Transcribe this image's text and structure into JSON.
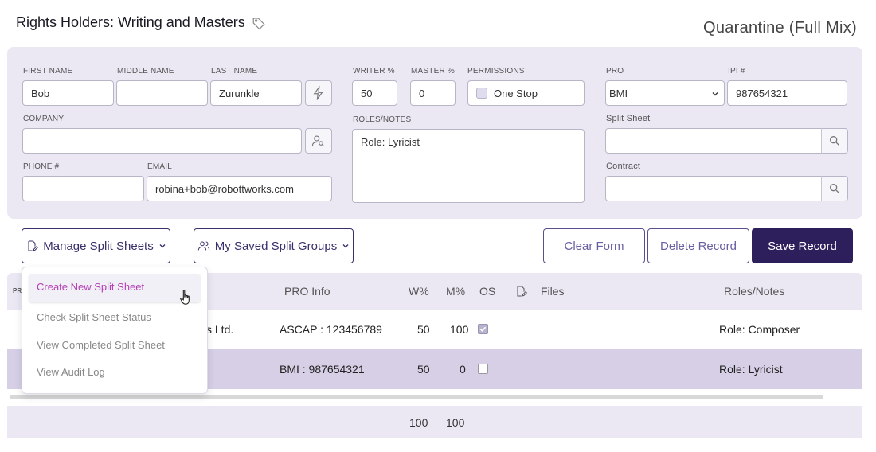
{
  "header": {
    "title": "Rights Holders: Writing and Masters",
    "track": "Quarantine (Full Mix)"
  },
  "form": {
    "first_name_label": "FIRST NAME",
    "first_name": "Bob",
    "middle_name_label": "MIDDLE NAME",
    "middle_name": "",
    "last_name_label": "LAST NAME",
    "last_name": "Zurunkle",
    "writer_label": "WRITER %",
    "writer": "50",
    "master_label": "MASTER %",
    "master": "0",
    "permissions_label": "PERMISSIONS",
    "one_stop": "One Stop",
    "pro_label": "PRO",
    "pro": "BMI",
    "ipi_label": "IPI #",
    "ipi": "987654321",
    "company_label": "COMPANY",
    "company": "",
    "roles_label": "ROLES/NOTES",
    "roles": "Role: Lyricist",
    "split_sheet_label": "Split Sheet",
    "split_sheet": "",
    "phone_label": "PHONE #",
    "phone": "",
    "email_label": "EMAIL",
    "email": "robina+bob@robottworks.com",
    "contract_label": "Contract",
    "contract": ""
  },
  "actions": {
    "manage": "Manage Split Sheets",
    "groups": "My Saved Split Groups",
    "clear": "Clear Form",
    "delete": "Delete Record",
    "save": "Save Record"
  },
  "dropdown": {
    "items": [
      "Create New Split Sheet",
      "Check Split Sheet Status",
      "View Completed Split Sheet",
      "View Audit Log"
    ]
  },
  "table": {
    "pr_stub": "PR",
    "headers": {
      "pro": "PRO Info",
      "w": "W%",
      "m": "M%",
      "os": "OS",
      "files": "Files",
      "roles": "Roles/Notes"
    },
    "rows": [
      {
        "name": "ks Ltd.",
        "pro": "ASCAP : 123456789",
        "w": "50",
        "m": "100",
        "os": true,
        "roles": "Role: Composer"
      },
      {
        "name": "",
        "pro": "BMI : 987654321",
        "w": "50",
        "m": "0",
        "os": false,
        "roles": "Role: Lyricist"
      }
    ],
    "totals": {
      "w": "100",
      "m": "100"
    }
  },
  "colors": {
    "accent": "#2d1e5c",
    "panel": "#ebe8f4",
    "highlight_row": "#d6cfe6",
    "link": "#b43fb4"
  }
}
